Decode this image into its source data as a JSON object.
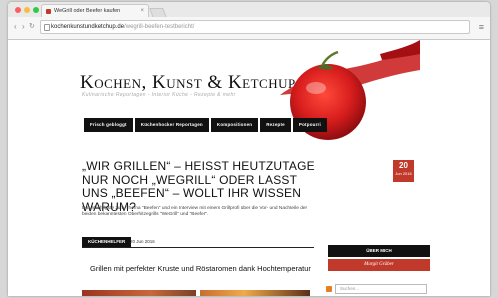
{
  "browser": {
    "tab_title": "WeGrill oder Beefer kaufen",
    "tab_close": "×",
    "url_host": "kochenkunstundketchup.de",
    "url_path": "/wegrill-beefen-testbericht/",
    "nav_back": "‹",
    "nav_forward": "›",
    "nav_reload": "↻",
    "menu": "≡"
  },
  "site": {
    "logo": "Kochen, Kunst & Ketchup",
    "tagline": "Kulinarische Reportagen - Interior Küche - Rezepte & mehr"
  },
  "nav": {
    "items": [
      "Frisch gebloggt",
      "Küchenhocker Reportagen",
      "Kompositionen",
      "Rezepte",
      "Potpourri"
    ]
  },
  "article": {
    "headline": "„Wir grillen“ – heisst heutzutage nur noch „WeGrill“ oder lasst uns „Beefen“ – wollt ihr wissen warum?",
    "date_day": "20",
    "date_month": "Jun 2016",
    "excerpt": "Das Wichtigste zum Thema \"Beefen\" und ein Interview mit einem Grillprofi über die Vor- und Nachteile der beiden bekanntesten Oberhitzegrills \"WeGrill\" und \"Beefer\".",
    "category": "KÜCHENHELFER",
    "meta_date": "20 Jun 2016",
    "subtitle": "Grillen mit perfekter Kruste und Röstaromen dank Hochtemperatur"
  },
  "sidebar": {
    "about": "ÜBER MICH",
    "author": "Margit Gräber",
    "search_placeholder": "Suchen..."
  },
  "colors": {
    "accent": "#c0392b",
    "nav_bg": "#111111"
  }
}
